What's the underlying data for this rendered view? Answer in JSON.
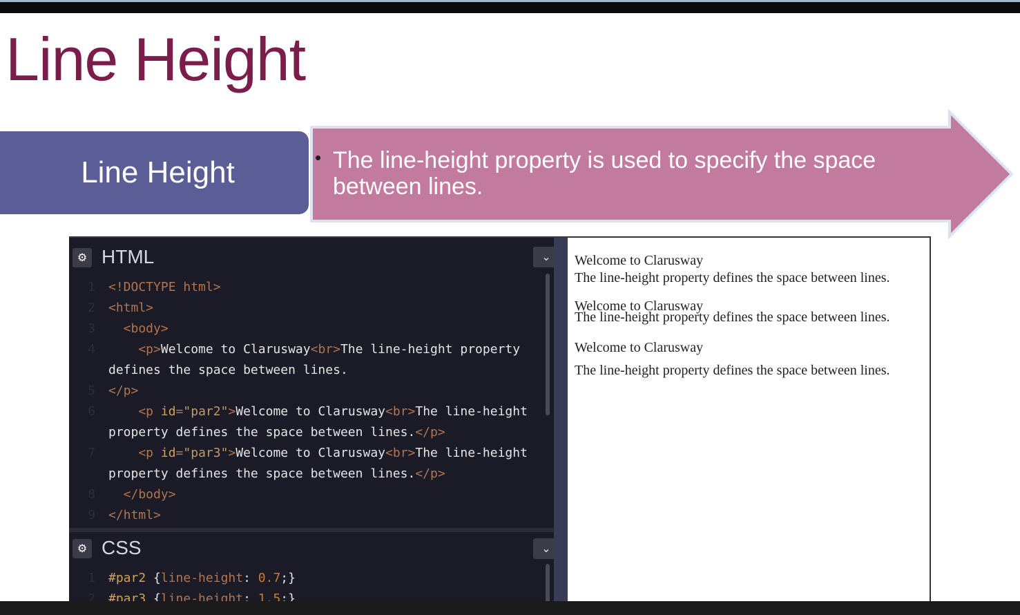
{
  "slide": {
    "title": "Line Height",
    "tab_label": "Line Height",
    "bullet_text": "The line-height property is used to specify the space between lines.",
    "colors": {
      "title": "#7a1d4b",
      "tab_bg": "#5b5e96",
      "arrow_bg": "#c27a9f"
    }
  },
  "html_panel": {
    "title": "HTML",
    "lines": [
      {
        "n": "1",
        "parts": [
          {
            "c": "tag",
            "t": "<!DOCTYPE html>"
          }
        ]
      },
      {
        "n": "2",
        "parts": [
          {
            "c": "tag",
            "t": "<html>"
          }
        ]
      },
      {
        "n": "3",
        "parts": [
          {
            "c": "tag",
            "t": "  <body>"
          }
        ]
      },
      {
        "n": "4",
        "parts": [
          {
            "c": "tag",
            "t": "    <p>"
          },
          {
            "c": "plain",
            "t": "Welcome to Clarusway"
          },
          {
            "c": "tag",
            "t": "<br>"
          },
          {
            "c": "plain",
            "t": "The line-height property"
          }
        ]
      },
      {
        "n": "",
        "parts": [
          {
            "c": "plain",
            "t": "defines the space between lines."
          }
        ]
      },
      {
        "n": "5",
        "parts": [
          {
            "c": "tag",
            "t": "</p>"
          }
        ]
      },
      {
        "n": "6",
        "parts": [
          {
            "c": "tag",
            "t": "    <p "
          },
          {
            "c": "attrn",
            "t": "id"
          },
          {
            "c": "tag",
            "t": "="
          },
          {
            "c": "attrv",
            "t": "\"par2\""
          },
          {
            "c": "tag",
            "t": ">"
          },
          {
            "c": "plain",
            "t": "Welcome to Clarusway"
          },
          {
            "c": "tag",
            "t": "<br>"
          },
          {
            "c": "plain",
            "t": "The line-height"
          }
        ]
      },
      {
        "n": "",
        "parts": [
          {
            "c": "plain",
            "t": "property defines the space between lines."
          },
          {
            "c": "tag",
            "t": "</p>"
          }
        ]
      },
      {
        "n": "7",
        "parts": [
          {
            "c": "tag",
            "t": "    <p "
          },
          {
            "c": "attrn",
            "t": "id"
          },
          {
            "c": "tag",
            "t": "="
          },
          {
            "c": "attrv",
            "t": "\"par3\""
          },
          {
            "c": "tag",
            "t": ">"
          },
          {
            "c": "plain",
            "t": "Welcome to Clarusway"
          },
          {
            "c": "tag",
            "t": "<br>"
          },
          {
            "c": "plain",
            "t": "The line-height"
          }
        ]
      },
      {
        "n": "",
        "parts": [
          {
            "c": "plain",
            "t": "property defines the space between lines."
          },
          {
            "c": "tag",
            "t": "</p>"
          }
        ]
      },
      {
        "n": "8",
        "parts": [
          {
            "c": "tag",
            "t": "  </body>"
          }
        ]
      },
      {
        "n": "9",
        "parts": [
          {
            "c": "tag",
            "t": "</html>"
          }
        ]
      }
    ]
  },
  "css_panel": {
    "title": "CSS",
    "lines": [
      {
        "n": "1",
        "parts": [
          {
            "c": "sel",
            "t": "#par2 "
          },
          {
            "c": "plain",
            "t": "{"
          },
          {
            "c": "tag",
            "t": "line-height"
          },
          {
            "c": "plain",
            "t": ": "
          },
          {
            "c": "num",
            "t": "0.7"
          },
          {
            "c": "plain",
            "t": ";}"
          }
        ]
      },
      {
        "n": "2",
        "parts": [
          {
            "c": "sel",
            "t": "#par3 "
          },
          {
            "c": "plain",
            "t": "{"
          },
          {
            "c": "tag",
            "t": "line-height"
          },
          {
            "c": "plain",
            "t": ": "
          },
          {
            "c": "num",
            "t": "1.5"
          },
          {
            "c": "plain",
            "t": ";}"
          }
        ]
      }
    ]
  },
  "preview": {
    "p1_line1": "Welcome to Clarusway",
    "p1_line2": "The line-height property defines the space between lines.",
    "p2_line1": "Welcome to Clarusway",
    "p2_line2": "The line-height property defines the space between lines.",
    "p3_line1": "Welcome to Clarusway",
    "p3_line2": "The line-height property defines the space between lines."
  }
}
